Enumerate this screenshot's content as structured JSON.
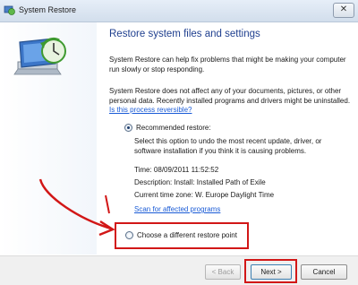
{
  "window": {
    "title": "System Restore",
    "close_glyph": "✕"
  },
  "content": {
    "heading": "Restore system files and settings",
    "paragraph1": "System Restore can help fix problems that might be making your computer run slowly or stop responding.",
    "paragraph2": "System Restore does not affect any of your documents, pictures, or other personal data. Recently installed programs and drivers might be uninstalled.",
    "reversible_link": "Is this process reversible?",
    "recommended_label": "Recommended restore:",
    "recommended_desc": "Select this option to undo the most recent update, driver, or software installation if you think it is causing problems.",
    "time": "Time: 08/09/2011 11:52:52",
    "description": "Description: Install: Installed Path of Exile",
    "timezone": "Current time zone: W. Europe Daylight Time",
    "scan_link": "Scan for affected programs",
    "different_label": "Choose a different restore point"
  },
  "footer": {
    "back": "< Back",
    "next": "Next >",
    "cancel": "Cancel"
  },
  "colors": {
    "annotation_red": "#d21717",
    "heading_blue": "#1f3f8f",
    "link_blue": "#1a5bd6"
  }
}
